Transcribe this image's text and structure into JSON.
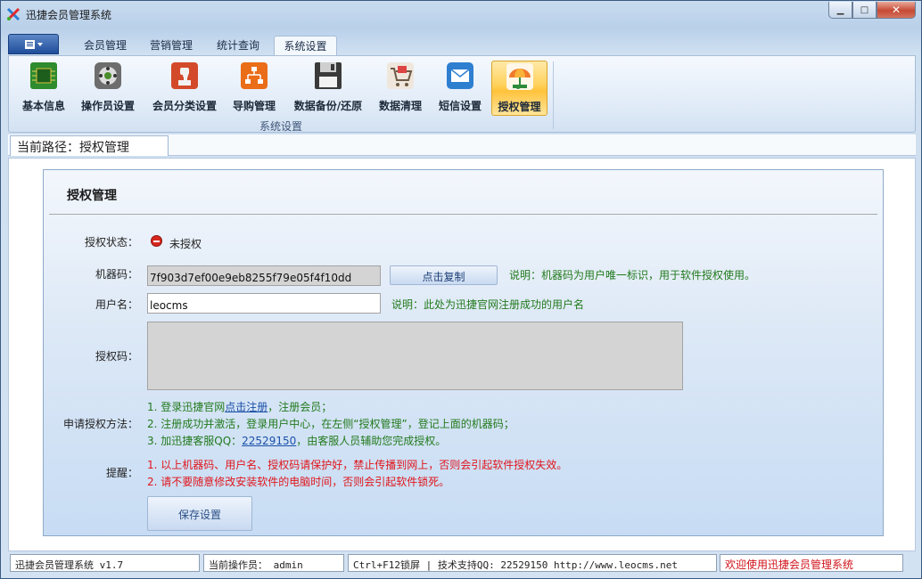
{
  "window": {
    "title": "迅捷会员管理系统",
    "close_symbol": "✕",
    "minimize_symbol": "▁",
    "maximize_symbol": "□"
  },
  "ribbon": {
    "menu_icon": "menu-icon",
    "tabs": [
      {
        "label": "会员管理"
      },
      {
        "label": "营销管理"
      },
      {
        "label": "统计查询"
      },
      {
        "label": "系统设置",
        "active": true
      }
    ],
    "items": [
      {
        "label": "基本信息",
        "icon": "chip-icon"
      },
      {
        "label": "操作员设置",
        "icon": "gamepad-icon"
      },
      {
        "label": "会员分类设置",
        "icon": "puzzle-icon"
      },
      {
        "label": "导购管理",
        "icon": "org-chart-icon"
      },
      {
        "label": "数据备份/还原",
        "icon": "floppy-disk-icon"
      },
      {
        "label": "数据清理",
        "icon": "shopping-cart-icon"
      },
      {
        "label": "短信设置",
        "icon": "envelope-icon"
      },
      {
        "label": "授权管理",
        "icon": "umbrella-icon",
        "active": true
      }
    ],
    "group_label": "系统设置"
  },
  "breadcrumb": {
    "text": "当前路径：授权管理"
  },
  "panel": {
    "title": "授权管理",
    "status_label": "授权状态：",
    "status_value": "未授权",
    "machine_label": "机器码：",
    "machine_value": "7f903d7ef00e9eb8255f79e05f4f10dd",
    "copy_button": "点击复制",
    "machine_note": "说明：机器码为用户唯一标识，用于软件授权使用。",
    "user_label": "用户名：",
    "user_value": "leocms",
    "user_note": "说明：此处为迅捷官网注册成功的用户名",
    "code_label": "授权码：",
    "code_value": "",
    "method_label": "申请授权方法：",
    "steps": {
      "s1_pre": "1. 登录迅捷官网",
      "s1_link": "点击注册",
      "s1_post": "，注册会员；",
      "s2": "2. 注册成功并激活，登录用户中心，在左侧“授权管理”，登记上面的机器码；",
      "s3_pre": "3. 加迅捷客服QQ：",
      "s3_link": "22529150",
      "s3_post": "，由客服人员辅助您完成授权。"
    },
    "remind_label": "提醒：",
    "warnings": [
      "1. 以上机器码、用户名、授权码请保护好，禁止传播到网上，否则会引起软件授权失效。",
      "2. 请不要随意修改安装软件的电脑时间，否则会引起软件锁死。"
    ],
    "save_button": "保存设置"
  },
  "statusbar": {
    "version": "迅捷会员管理系统 v1.7",
    "operator": "当前操作员： admin",
    "hotkey_support": "Ctrl+F12锁屏 | 技术支持QQ:  22529150       http://www.leocms.net",
    "welcome": "欢迎使用迅捷会员管理系统"
  },
  "colors": {
    "accent": "#1f4d9a",
    "note_green": "#227a1d",
    "warn_red": "#e0151b",
    "active_yellow": "#ffd15a"
  }
}
